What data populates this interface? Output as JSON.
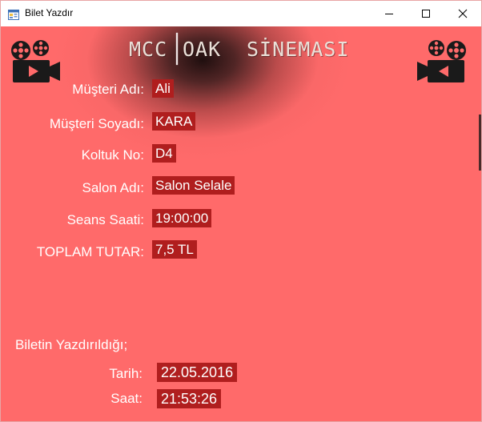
{
  "window": {
    "title": "Bilet Yazdır",
    "icon": "form-app-icon",
    "controls": {
      "minimize_icon": "minimize-icon",
      "maximize_icon": "maximize-icon",
      "close_icon": "close-icon"
    }
  },
  "header": {
    "title_part1": "MCC",
    "title_part2": "OAK",
    "title_part3": "SİNEMASI",
    "left_icon": "film-projector-icon",
    "right_icon": "film-projector-icon"
  },
  "ticket": {
    "fields": [
      {
        "label": "Müşteri Adı:",
        "value": "Ali"
      },
      {
        "label": "Müşteri Soyadı:",
        "value": "KARA"
      },
      {
        "label": "Koltuk No:",
        "value": "D4"
      },
      {
        "label": "Salon Adı:",
        "value": "Salon Selale"
      },
      {
        "label": "Seans Saati:",
        "value": "19:00:00"
      },
      {
        "label": "TOPLAM TUTAR:",
        "value": "7,5 TL"
      }
    ]
  },
  "printed": {
    "heading": "Biletin Yazdırıldığı;",
    "date_label": "Tarih:",
    "date_value": "22.05.2016",
    "time_label": "Saat:",
    "time_value": "21:53:26"
  },
  "colors": {
    "background": "#ff6a6a",
    "value_background": "#b01e1e",
    "text": "#ffffff"
  }
}
